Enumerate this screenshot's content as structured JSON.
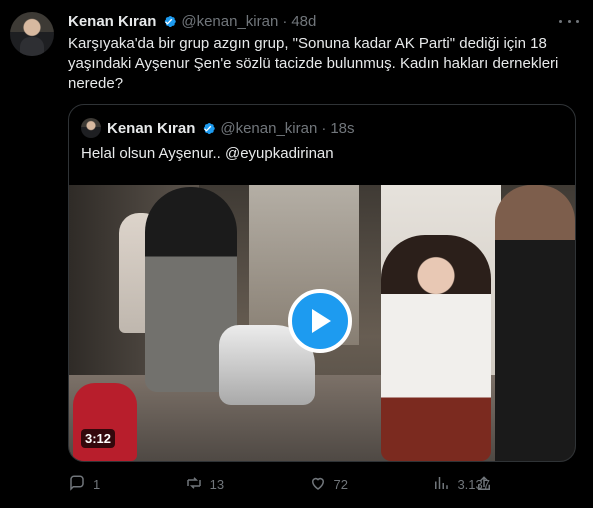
{
  "tweet": {
    "author": "Kenan Kıran",
    "handle": "@kenan_kiran",
    "separator": "·",
    "time": "48d",
    "text": "Karşıyaka'da bir grup azgın grup, \"Sonuna kadar AK Parti\" dediği için 18 yaşındaki Ayşenur Şen'e sözlü tacizde bulunmuş. Kadın hakları dernekleri nerede?",
    "icons": {
      "verified": "verified-check-icon",
      "more": "more-options-icon"
    }
  },
  "quoted_tweet": {
    "author": "Kenan Kıran",
    "handle": "@kenan_kiran",
    "separator": "·",
    "time": "18s",
    "text": "Helal olsun Ayşenur.. @eyupkadirinan",
    "video": {
      "duration": "3:12",
      "play_icon": "play-icon"
    }
  },
  "actions": {
    "reply_count": "1",
    "retweet_count": "13",
    "like_count": "72",
    "view_count": "3.137",
    "icons": [
      "reply-icon",
      "retweet-icon",
      "like-icon",
      "views-icon",
      "share-icon"
    ]
  },
  "colors": {
    "background": "#000000",
    "text": "#e7e9ea",
    "muted": "#71767b",
    "accent": "#1d9bf0",
    "border": "#2f3336"
  }
}
